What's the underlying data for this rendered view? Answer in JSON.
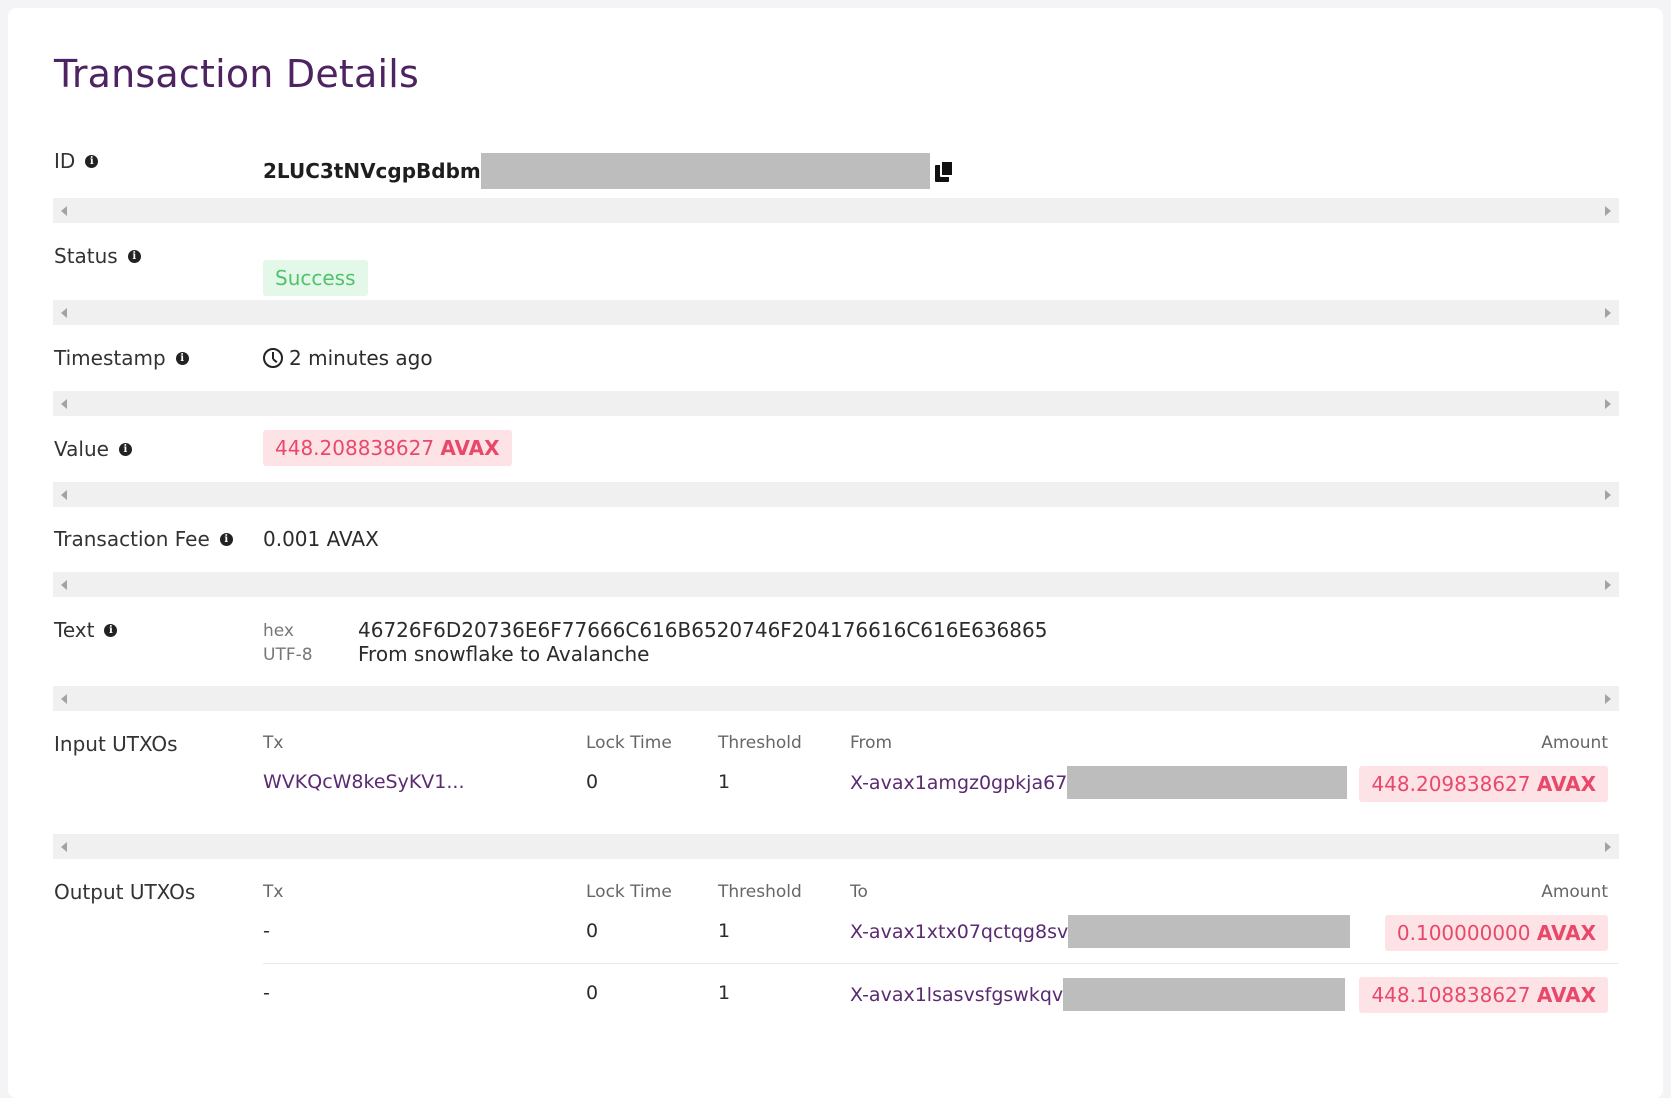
{
  "page_title": "Transaction Details",
  "id_row": {
    "label": "ID",
    "value": "2LUC3tNVcgpBdbm"
  },
  "status_row": {
    "label": "Status",
    "value": "Success"
  },
  "timestamp_row": {
    "label": "Timestamp",
    "value": "2 minutes ago"
  },
  "value_row": {
    "label": "Value",
    "amount": "448.208838627",
    "unit": "AVAX"
  },
  "fee_row": {
    "label": "Transaction Fee",
    "value": "0.001 AVAX"
  },
  "text_row": {
    "label": "Text",
    "hex_label": "hex",
    "hex_value": "46726F6D20736E6F77666C616B6520746F204176616C616E636865",
    "utf8_label": "UTF-8",
    "utf8_value": "From snowflake to Avalanche"
  },
  "inputs": {
    "label": "Input UTXOs",
    "headers": {
      "tx": "Tx",
      "lock_time": "Lock Time",
      "threshold": "Threshold",
      "from": "From",
      "amount": "Amount"
    },
    "rows": [
      {
        "tx": "WVKQcW8keSyKV1...",
        "lock_time": "0",
        "threshold": "1",
        "address": "X-avax1amgz0gpkja67",
        "amount": "448.209838627",
        "unit": "AVAX"
      }
    ]
  },
  "outputs": {
    "label": "Output UTXOs",
    "headers": {
      "tx": "Tx",
      "lock_time": "Lock Time",
      "threshold": "Threshold",
      "to": "To",
      "amount": "Amount"
    },
    "rows": [
      {
        "tx": "-",
        "lock_time": "0",
        "threshold": "1",
        "address": "X-avax1xtx07qctqg8sv",
        "amount": "0.100000000",
        "unit": "AVAX"
      },
      {
        "tx": "-",
        "lock_time": "0",
        "threshold": "1",
        "address": "X-avax1lsasvsfgswkqv",
        "amount": "448.108838627",
        "unit": "AVAX"
      }
    ]
  },
  "colors": {
    "title": "#4d2362",
    "success_bg": "#e4f8e9",
    "success_text": "#4fc26b",
    "amount_bg": "#fde3e6",
    "amount_text": "#e8496a",
    "link": "#5a2a72"
  }
}
